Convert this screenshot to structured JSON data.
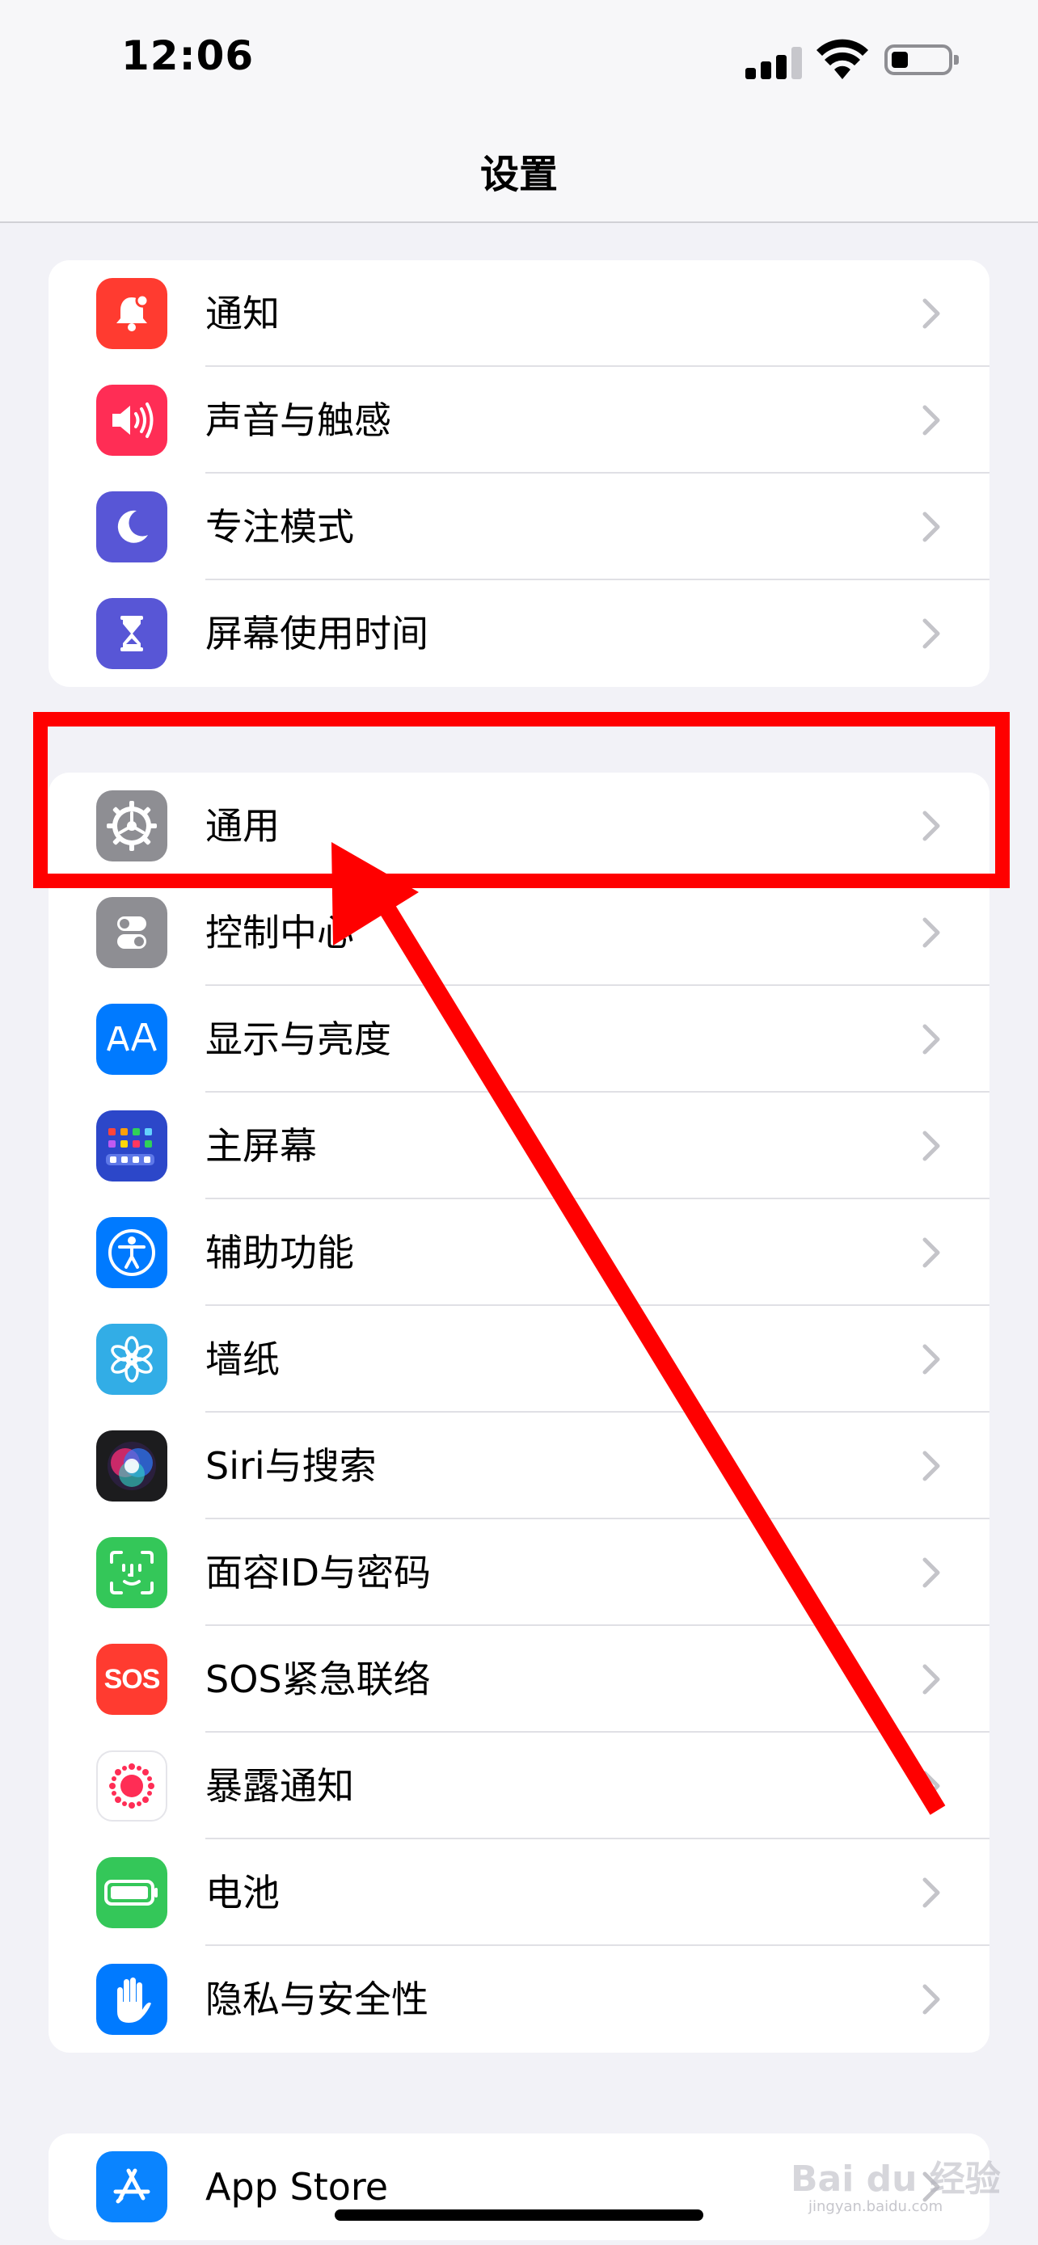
{
  "status_bar": {
    "time": "12:06"
  },
  "nav": {
    "title": "设置"
  },
  "groups": [
    {
      "items": [
        {
          "label": "通知",
          "icon": "notifications-bell-icon",
          "color": "#ff3b30"
        },
        {
          "label": "声音与触感",
          "icon": "sound-speaker-icon",
          "color": "#ff2d55"
        },
        {
          "label": "专注模式",
          "icon": "moon-icon",
          "color": "#5856d6"
        },
        {
          "label": "屏幕使用时间",
          "icon": "hourglass-icon",
          "color": "#5856d6"
        }
      ]
    },
    {
      "items": [
        {
          "label": "通用",
          "icon": "gear-icon",
          "color": "#8e8e93"
        },
        {
          "label": "控制中心",
          "icon": "toggles-icon",
          "color": "#8e8e93"
        },
        {
          "label": "显示与亮度",
          "icon": "text-size-icon",
          "color": "#007aff"
        },
        {
          "label": "主屏幕",
          "icon": "home-screen-grid-icon",
          "color": "#2c47c9"
        },
        {
          "label": "辅助功能",
          "icon": "accessibility-icon",
          "color": "#007aff"
        },
        {
          "label": "墙纸",
          "icon": "flower-icon",
          "color": "#32ade6"
        },
        {
          "label": "Siri与搜索",
          "icon": "siri-icon",
          "color": "#1c1c1e"
        },
        {
          "label": "面容ID与密码",
          "icon": "face-id-icon",
          "color": "#34c759"
        },
        {
          "label": "SOS紧急联络",
          "icon": "sos-icon",
          "color": "#ff3b30",
          "icon_text": "SOS"
        },
        {
          "label": "暴露通知",
          "icon": "exposure-dots-icon",
          "color": "#ffffff"
        },
        {
          "label": "电池",
          "icon": "battery-icon",
          "color": "#34c759"
        },
        {
          "label": "隐私与安全性",
          "icon": "hand-icon",
          "color": "#007aff"
        }
      ]
    },
    {
      "items": [
        {
          "label": "App Store",
          "icon": "app-store-icon",
          "color": "#0a84ff"
        }
      ]
    }
  ],
  "watermark": {
    "text": "Bai du 经验",
    "sub": "jingyan.baidu.com"
  },
  "annotation_color": "#ff0000"
}
